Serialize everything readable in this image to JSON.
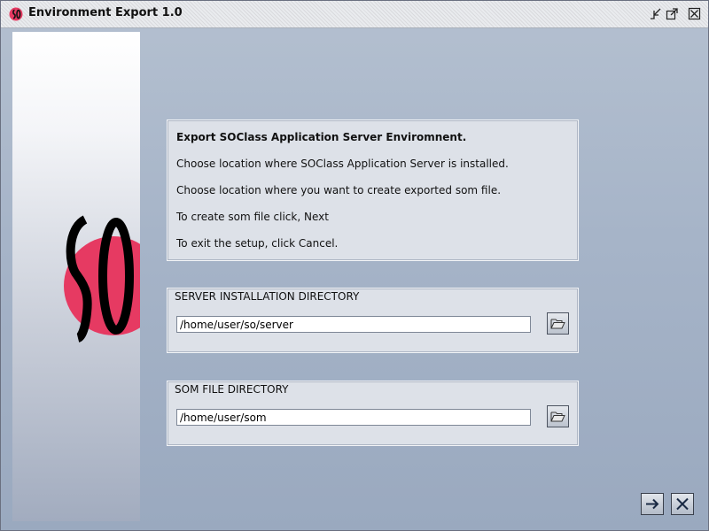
{
  "window": {
    "title": "Environment Export 1.0",
    "icon": "so-app-icon",
    "controls": [
      "minimize-icon",
      "maximize-icon",
      "close-icon"
    ]
  },
  "brand": {
    "logo": "so-logo",
    "accent_color": "#e63a62"
  },
  "info": {
    "title": "Export SOClass Application Server Enviromnent.",
    "line1": "Choose location where SOClass Application Server is installed.",
    "line2": "Choose location where you want to create exported som file.",
    "line3": "To create som file click, Next",
    "line4": "To exit the setup, click Cancel."
  },
  "server_dir": {
    "label": "SERVER INSTALLATION DIRECTORY",
    "value": "/home/user/so/server",
    "browse_icon": "folder-open-icon"
  },
  "som_dir": {
    "label": "SOM FILE DIRECTORY",
    "value": "/home/user/som",
    "browse_icon": "folder-open-icon"
  },
  "buttons": {
    "next_icon": "arrow-right-icon",
    "cancel_icon": "close-x-icon"
  }
}
